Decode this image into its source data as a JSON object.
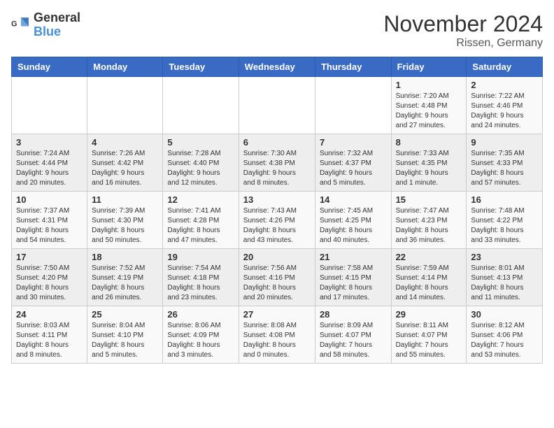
{
  "header": {
    "logo_general": "General",
    "logo_blue": "Blue",
    "month_year": "November 2024",
    "location": "Rissen, Germany"
  },
  "weekdays": [
    "Sunday",
    "Monday",
    "Tuesday",
    "Wednesday",
    "Thursday",
    "Friday",
    "Saturday"
  ],
  "weeks": [
    [
      {
        "day": "",
        "info": ""
      },
      {
        "day": "",
        "info": ""
      },
      {
        "day": "",
        "info": ""
      },
      {
        "day": "",
        "info": ""
      },
      {
        "day": "",
        "info": ""
      },
      {
        "day": "1",
        "info": "Sunrise: 7:20 AM\nSunset: 4:48 PM\nDaylight: 9 hours\nand 27 minutes."
      },
      {
        "day": "2",
        "info": "Sunrise: 7:22 AM\nSunset: 4:46 PM\nDaylight: 9 hours\nand 24 minutes."
      }
    ],
    [
      {
        "day": "3",
        "info": "Sunrise: 7:24 AM\nSunset: 4:44 PM\nDaylight: 9 hours\nand 20 minutes."
      },
      {
        "day": "4",
        "info": "Sunrise: 7:26 AM\nSunset: 4:42 PM\nDaylight: 9 hours\nand 16 minutes."
      },
      {
        "day": "5",
        "info": "Sunrise: 7:28 AM\nSunset: 4:40 PM\nDaylight: 9 hours\nand 12 minutes."
      },
      {
        "day": "6",
        "info": "Sunrise: 7:30 AM\nSunset: 4:38 PM\nDaylight: 9 hours\nand 8 minutes."
      },
      {
        "day": "7",
        "info": "Sunrise: 7:32 AM\nSunset: 4:37 PM\nDaylight: 9 hours\nand 5 minutes."
      },
      {
        "day": "8",
        "info": "Sunrise: 7:33 AM\nSunset: 4:35 PM\nDaylight: 9 hours\nand 1 minute."
      },
      {
        "day": "9",
        "info": "Sunrise: 7:35 AM\nSunset: 4:33 PM\nDaylight: 8 hours\nand 57 minutes."
      }
    ],
    [
      {
        "day": "10",
        "info": "Sunrise: 7:37 AM\nSunset: 4:31 PM\nDaylight: 8 hours\nand 54 minutes."
      },
      {
        "day": "11",
        "info": "Sunrise: 7:39 AM\nSunset: 4:30 PM\nDaylight: 8 hours\nand 50 minutes."
      },
      {
        "day": "12",
        "info": "Sunrise: 7:41 AM\nSunset: 4:28 PM\nDaylight: 8 hours\nand 47 minutes."
      },
      {
        "day": "13",
        "info": "Sunrise: 7:43 AM\nSunset: 4:26 PM\nDaylight: 8 hours\nand 43 minutes."
      },
      {
        "day": "14",
        "info": "Sunrise: 7:45 AM\nSunset: 4:25 PM\nDaylight: 8 hours\nand 40 minutes."
      },
      {
        "day": "15",
        "info": "Sunrise: 7:47 AM\nSunset: 4:23 PM\nDaylight: 8 hours\nand 36 minutes."
      },
      {
        "day": "16",
        "info": "Sunrise: 7:48 AM\nSunset: 4:22 PM\nDaylight: 8 hours\nand 33 minutes."
      }
    ],
    [
      {
        "day": "17",
        "info": "Sunrise: 7:50 AM\nSunset: 4:20 PM\nDaylight: 8 hours\nand 30 minutes."
      },
      {
        "day": "18",
        "info": "Sunrise: 7:52 AM\nSunset: 4:19 PM\nDaylight: 8 hours\nand 26 minutes."
      },
      {
        "day": "19",
        "info": "Sunrise: 7:54 AM\nSunset: 4:18 PM\nDaylight: 8 hours\nand 23 minutes."
      },
      {
        "day": "20",
        "info": "Sunrise: 7:56 AM\nSunset: 4:16 PM\nDaylight: 8 hours\nand 20 minutes."
      },
      {
        "day": "21",
        "info": "Sunrise: 7:58 AM\nSunset: 4:15 PM\nDaylight: 8 hours\nand 17 minutes."
      },
      {
        "day": "22",
        "info": "Sunrise: 7:59 AM\nSunset: 4:14 PM\nDaylight: 8 hours\nand 14 minutes."
      },
      {
        "day": "23",
        "info": "Sunrise: 8:01 AM\nSunset: 4:13 PM\nDaylight: 8 hours\nand 11 minutes."
      }
    ],
    [
      {
        "day": "24",
        "info": "Sunrise: 8:03 AM\nSunset: 4:11 PM\nDaylight: 8 hours\nand 8 minutes."
      },
      {
        "day": "25",
        "info": "Sunrise: 8:04 AM\nSunset: 4:10 PM\nDaylight: 8 hours\nand 5 minutes."
      },
      {
        "day": "26",
        "info": "Sunrise: 8:06 AM\nSunset: 4:09 PM\nDaylight: 8 hours\nand 3 minutes."
      },
      {
        "day": "27",
        "info": "Sunrise: 8:08 AM\nSunset: 4:08 PM\nDaylight: 8 hours\nand 0 minutes."
      },
      {
        "day": "28",
        "info": "Sunrise: 8:09 AM\nSunset: 4:07 PM\nDaylight: 7 hours\nand 58 minutes."
      },
      {
        "day": "29",
        "info": "Sunrise: 8:11 AM\nSunset: 4:07 PM\nDaylight: 7 hours\nand 55 minutes."
      },
      {
        "day": "30",
        "info": "Sunrise: 8:12 AM\nSunset: 4:06 PM\nDaylight: 7 hours\nand 53 minutes."
      }
    ]
  ]
}
